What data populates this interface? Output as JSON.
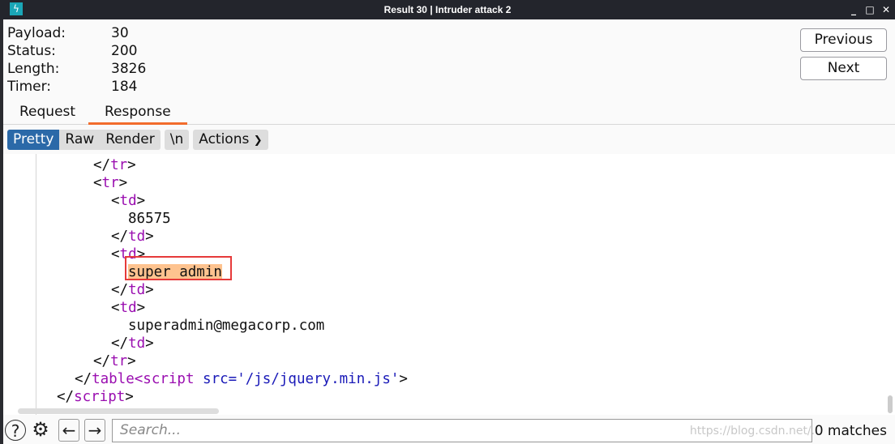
{
  "window": {
    "title": "Result 30 | Intruder attack 2",
    "app_icon": "burp-lightning-icon"
  },
  "info": [
    {
      "label": "Payload:",
      "value": "30"
    },
    {
      "label": "Status:",
      "value": "200"
    },
    {
      "label": "Length:",
      "value": "3826"
    },
    {
      "label": "Timer:",
      "value": "184"
    }
  ],
  "nav": {
    "previous": "Previous",
    "next": "Next"
  },
  "tabs": {
    "request": "Request",
    "response": "Response",
    "active": "Response"
  },
  "toolbar": {
    "pretty": "Pretty",
    "raw": "Raw",
    "render": "Render",
    "newline": "\\n",
    "actions": "Actions"
  },
  "code": {
    "l1": {
      "o": "</",
      "t": "tr",
      "c": ">"
    },
    "l2": {
      "o": "<",
      "t": "tr",
      "c": ">"
    },
    "l3": {
      "o": "<",
      "t": "td",
      "c": ">"
    },
    "l4": "86575",
    "l5": {
      "o": "</",
      "t": "td",
      "c": ">"
    },
    "l6": {
      "o": "<",
      "t": "td",
      "c": ">"
    },
    "l7": "super admin",
    "l8": {
      "o": "</",
      "t": "td",
      "c": ">"
    },
    "l9": {
      "o": "<",
      "t": "td",
      "c": ">"
    },
    "l10": "superadmin@megacorp.com",
    "l11": {
      "o": "</",
      "t": "td",
      "c": ">"
    },
    "l12": {
      "o": "</",
      "t": "tr",
      "c": ">"
    },
    "l13": {
      "o": "</",
      "t": "table<script",
      "attr": " src=",
      "val": "'/js/jquery.min.js'",
      "c": ">"
    },
    "l14": {
      "o": "</",
      "t": "script",
      "c": ">"
    }
  },
  "search": {
    "placeholder": "Search...",
    "matches": "0 matches",
    "watermark": "https://blog.csdn.net/..."
  }
}
